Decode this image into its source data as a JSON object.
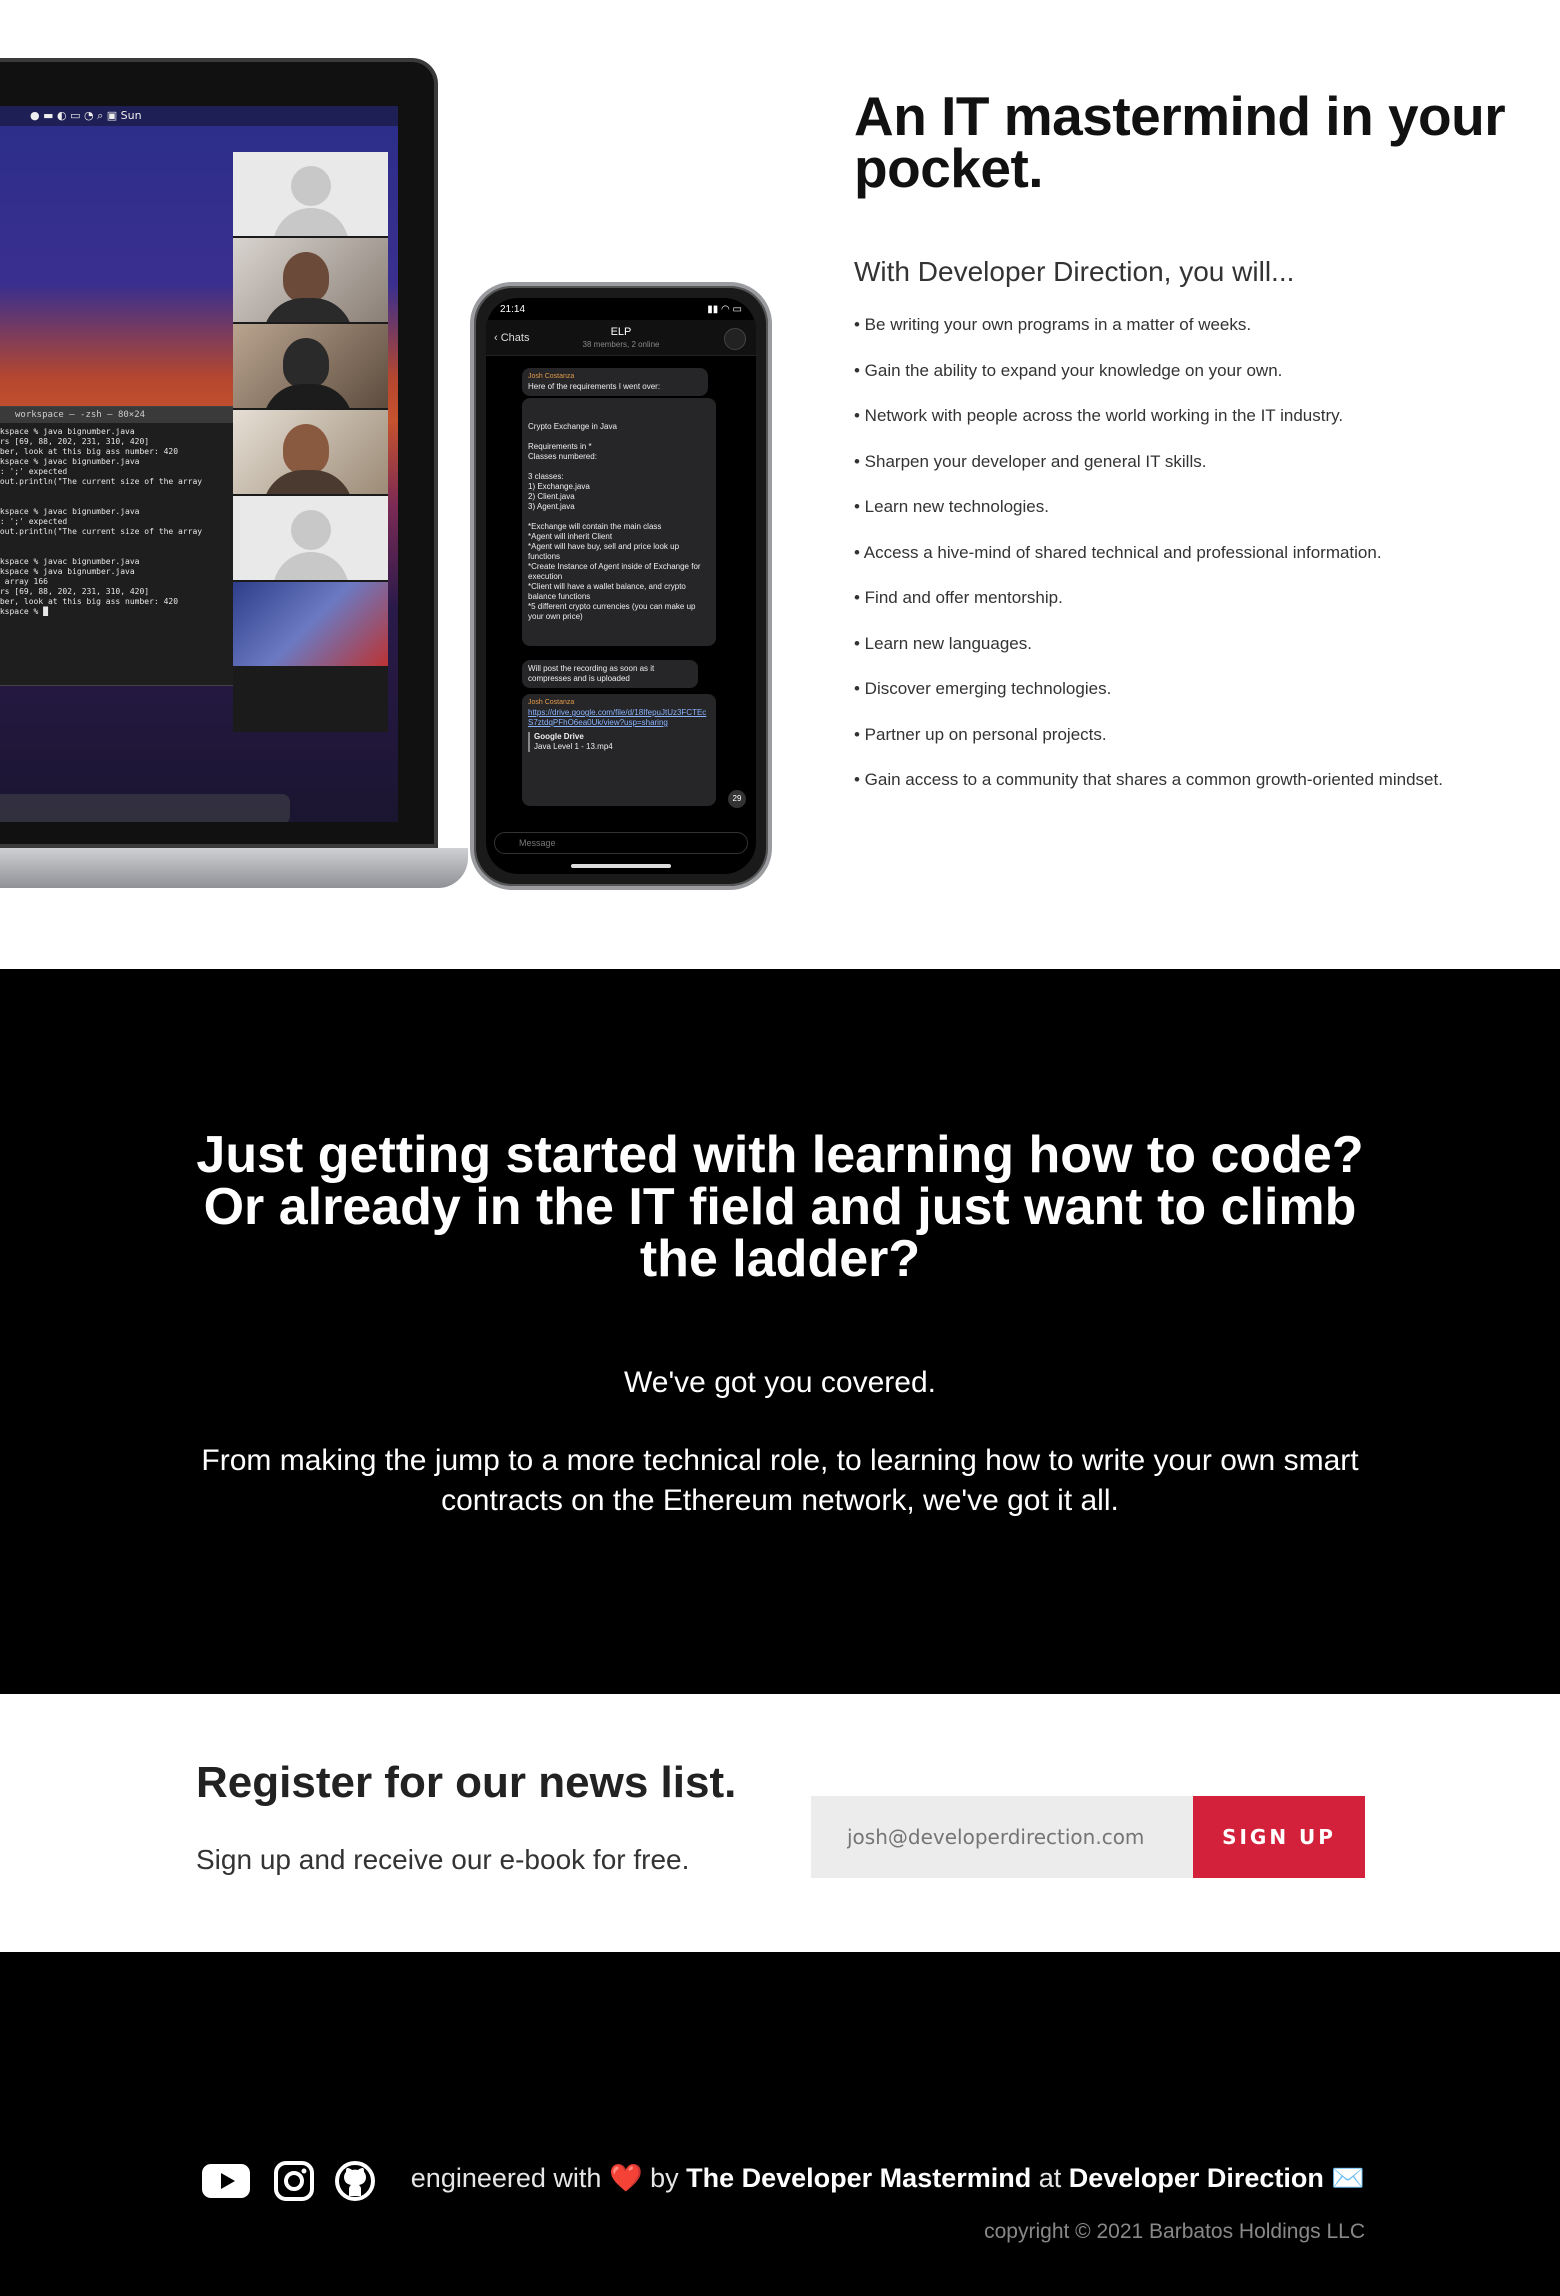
{
  "hero": {
    "title": "An IT mastermind in your pocket.",
    "subtitle": "With Developer Direction, you will...",
    "benefits": [
      "• Be writing your own programs in a matter of weeks.",
      "• Gain the ability to expand your knowledge on your own.",
      "• Network with people across the world working in the IT industry.",
      "• Sharpen your developer and general IT skills.",
      "• Learn new technologies.",
      "• Access a hive-mind of shared technical and professional information.",
      "• Find and offer mentorship.",
      "• Learn new languages.",
      "• Discover emerging technologies.",
      "• Partner up on personal projects.",
      "• Gain access to a community that shares a common growth-oriented mindset."
    ]
  },
  "laptop": {
    "menubar_right": "Sun",
    "terminal_title": "workspace — -zsh — 80×24",
    "terminal_lines": "rkspace % java bignumber.java\ners [69, 88, 202, 231, 310, 420]\nmber, look at this big ass number: 420\nrkspace % javac bignumber.java\nr: ';' expected\n.out.println(\"The current size of the array\n\n\nrkspace % javac bignumber.java\nr: ';' expected\n.out.println(\"The current size of the array\n\n\nrkspace % javac bignumber.java\nrkspace % java bignumber.java\ne array 166\ners [69, 88, 202, 231, 310, 420]\nmber, look at this big ass number: 420\nrkspace % █"
  },
  "phone": {
    "time": "21:14",
    "back_label": "Chats",
    "chat_title": "ELP",
    "chat_subtitle": "38 members, 2 online",
    "messages": {
      "m1_sender": "Josh Costanza",
      "m1_text": "Here of the requirements I went over:",
      "m2_text": "Crypto Exchange in Java\n\nRequirements in *\nClasses numbered:\n\n3 classes:\n1) Exchange.java\n2) Client.java\n3) Agent.java\n\n*Exchange will contain the main class\n*Agent will inherit Client\n*Agent will have buy, sell and price look up functions\n*Create Instance of Agent inside of Exchange for execution\n*Client will have a wallet balance, and crypto balance functions\n*5 different crypto currencies (you can make up your own price)",
      "m3_text": "Will post the recording as soon as it compresses and is uploaded",
      "m4_sender": "Josh Costanza",
      "m4_link": "https://drive.google.com/file/d/18IfepuJtUz3FCTEcS7ztdqPFhO6ea0Uk/view?usp=sharing",
      "m4_card_title": "Google Drive",
      "m4_card_sub": "Java Level 1 - 13.mp4",
      "unread": "29"
    },
    "input_placeholder": "Message"
  },
  "banner": {
    "title": "Just getting started with learning how to code? Or already in the IT field and just want to climb the ladder?",
    "p1": "We've got you covered.",
    "p2": "From making the jump to a more technical role, to learning how to write your own smart contracts on the Ethereum network, we've got it all."
  },
  "newsletter": {
    "title": "Register for our news list.",
    "subtitle": "Sign up and receive our e-book for free.",
    "email_placeholder": "josh@developerdirection.com",
    "button_label": "SIGN UP",
    "button_color": "#d3213c"
  },
  "footer": {
    "prefix": "engineered with",
    "heart": "❤️",
    "by": "by",
    "author": "The Developer Mastermind",
    "at": "at",
    "company": "Developer Direction",
    "mail_icon": "✉️",
    "copyright": "copyright © 2021 Barbatos Holdings LLC",
    "social_icons": [
      "youtube-icon",
      "instagram-icon",
      "github-icon"
    ]
  }
}
